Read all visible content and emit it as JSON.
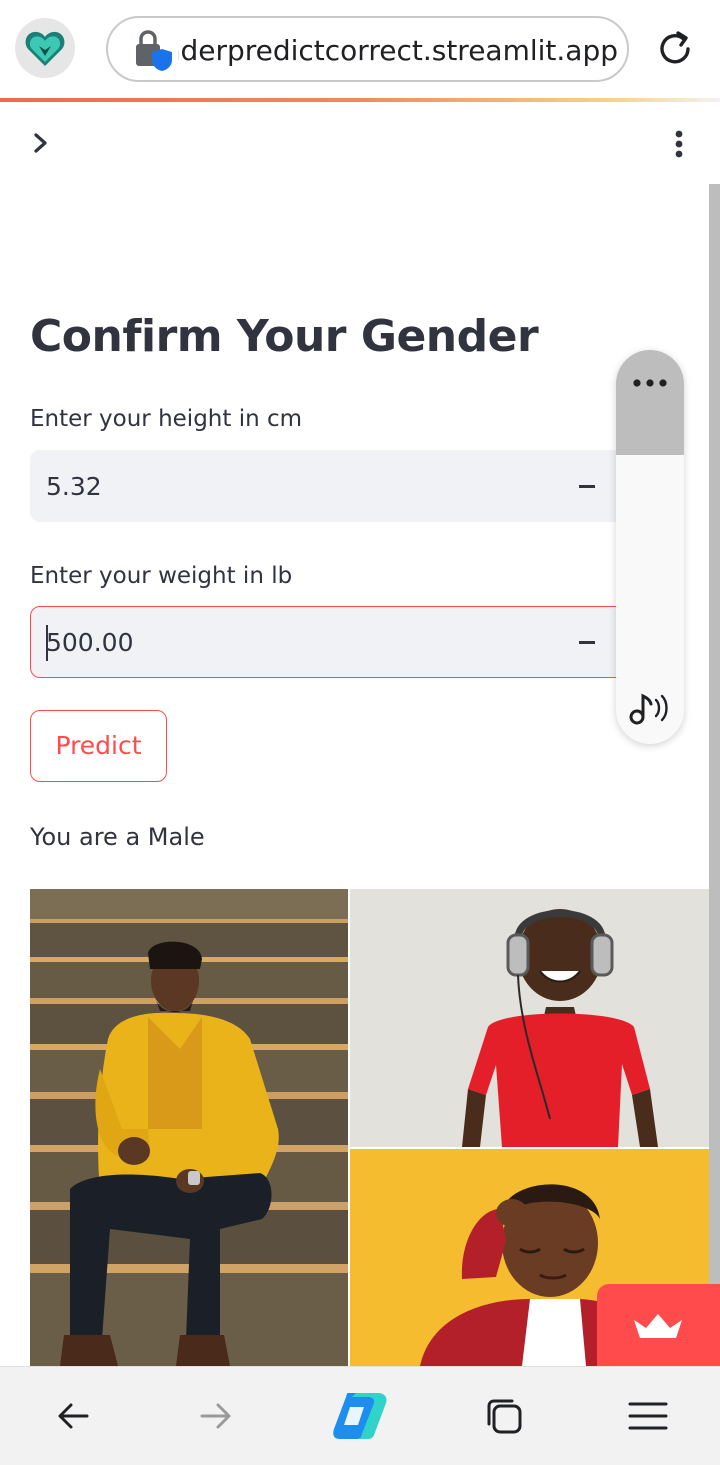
{
  "browser": {
    "url": "genderpredictcorrect.streamlit.app"
  },
  "page": {
    "title": "Confirm Your Gender",
    "height_label": "Enter your height in cm",
    "height_value": "5.32",
    "weight_label": "Enter your weight in lb",
    "weight_value": "500.00",
    "predict_label": "Predict",
    "result_text": "You are a Male"
  },
  "colors": {
    "accent": "#ff4b4b",
    "text": "#31333f",
    "input_bg": "#f0f2f6"
  },
  "icons": {
    "browser_logo": "heart-shield-icon",
    "lock": "lock-shield-icon",
    "reload": "reload-icon",
    "chevron": "chevron-right-icon",
    "menu": "kebab-menu-icon",
    "audio_more": "more-dots-icon",
    "audio": "music-note-icon",
    "badge": "crown-icon",
    "back": "back-arrow-icon",
    "forward": "forward-arrow-icon",
    "copilot": "copilot-icon",
    "tabs": "tabs-icon",
    "hamburger": "hamburger-menu-icon"
  }
}
